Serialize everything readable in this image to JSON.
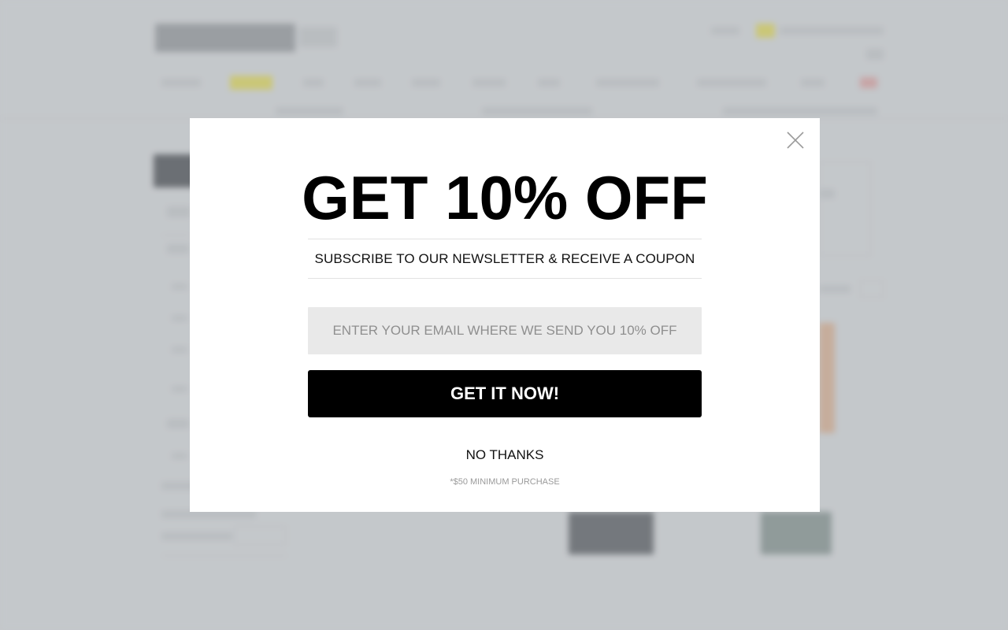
{
  "modal": {
    "headline": "GET 10% OFF",
    "subtitle": "SUBSCRIBE TO OUR NEWSLETTER & RECEIVE A COUPON",
    "email_placeholder": "ENTER YOUR EMAIL WHERE WE SEND YOU 10% OFF",
    "email_value": "",
    "submit_label": "GET IT NOW!",
    "decline_label": "NO THANKS",
    "fine_print": "*$50 MINIMUM PURCHASE",
    "close_icon": "close-icon"
  },
  "colors": {
    "modal_bg": "#ffffff",
    "button_bg": "#000000",
    "button_text": "#ffffff",
    "input_bg": "#e9e9e9",
    "backdrop": "#c4c7ca"
  }
}
